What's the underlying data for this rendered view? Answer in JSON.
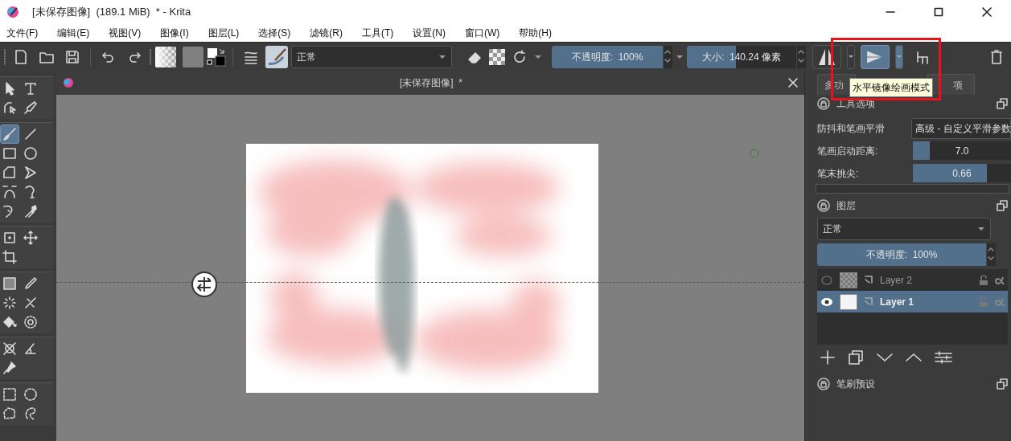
{
  "window": {
    "title": "[未保存图像]  (189.1 MiB)  * - Krita"
  },
  "menu": [
    "文件(F)",
    "编辑(E)",
    "视图(V)",
    "图像(I)",
    "图层(L)",
    "选择(S)",
    "滤镜(R)",
    "工具(T)",
    "设置(N)",
    "窗口(W)",
    "帮助(H)"
  ],
  "toolbar": {
    "blend_mode": "正常",
    "opacity": {
      "label": "不透明度:  100%",
      "level": 1.0
    },
    "size": {
      "label": "大小:  140.24 像素",
      "level": 0.45
    },
    "mirror": [
      {
        "selected": false
      },
      {
        "selected": true
      }
    ],
    "tooltip": "水平镜像绘画模式"
  },
  "toolbox": [
    [
      {
        "selected": false
      },
      {
        "selected": false
      },
      {
        "selected": false
      },
      {
        "selected": false
      }
    ],
    [
      {
        "selected": true
      },
      {
        "selected": false
      },
      {
        "selected": false
      },
      {
        "selected": false
      },
      {
        "selected": false
      },
      {
        "selected": false
      },
      {
        "selected": false
      },
      {
        "selected": false
      },
      {
        "selected": false
      },
      {
        "selected": false
      }
    ],
    [
      {
        "selected": false
      },
      {
        "selected": false
      },
      {
        "selected": false
      }
    ],
    [
      {
        "selected": false
      },
      {
        "selected": false
      },
      {
        "selected": false
      },
      {
        "selected": false
      },
      {
        "selected": false
      },
      {
        "selected": false
      }
    ],
    [
      {
        "selected": false
      },
      {
        "selected": false
      },
      {
        "selected": false
      }
    ],
    [
      {
        "selected": false
      },
      {
        "selected": false
      },
      {
        "selected": false
      },
      {
        "selected": false
      }
    ]
  ],
  "document": {
    "title": "[未保存图像]  *"
  },
  "docker_tabs": [
    "多功",
    "项"
  ],
  "tool_options": {
    "title": "工具选项",
    "rows": [
      {
        "kind": "dropdown",
        "label": "防抖和笔画平滑",
        "value": "高级 - 自定义平滑参数"
      },
      {
        "kind": "slider",
        "label": "笔画启动距离:",
        "value": "7.0",
        "level": 0.17
      },
      {
        "kind": "slider",
        "label": "笔末挑尖:",
        "value": "0.66",
        "level": 0.75
      }
    ]
  },
  "layers": {
    "title": "图层",
    "blend_mode": "正常",
    "opacity": {
      "label": "不透明度:  100%",
      "level": 1.0
    },
    "items": [
      {
        "name": "Layer 2",
        "visible": false,
        "selected": false
      },
      {
        "name": "Layer 1",
        "visible": true,
        "selected": true
      }
    ]
  },
  "brush_presets": {
    "title": "笔刷预设"
  }
}
